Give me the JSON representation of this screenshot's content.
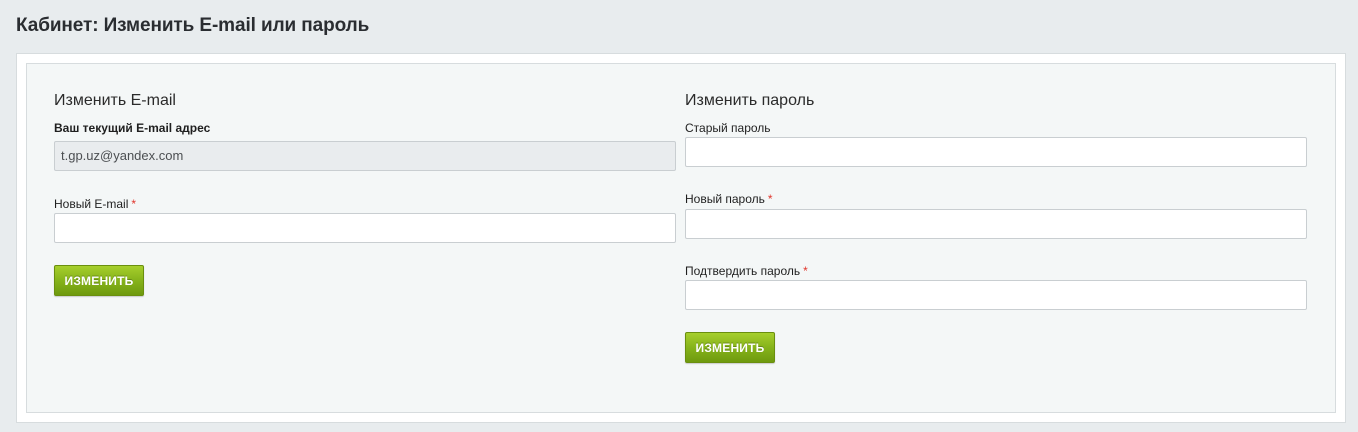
{
  "page": {
    "title": "Кабинет: Изменить E-mail или пароль"
  },
  "email_section": {
    "title": "Изменить E-mail",
    "current_label": "Ваш текущий E-mail адрес",
    "current_value": "t.gp.uz@yandex.com",
    "new_label": "Новый E-mail",
    "new_value": "",
    "required_mark": "*",
    "submit_label": "ИЗМЕНИТЬ"
  },
  "password_section": {
    "title": "Изменить пароль",
    "old_label": "Старый пароль",
    "old_value": "",
    "new_label": "Новый пароль",
    "new_value": "",
    "confirm_label": "Подтвердить пароль",
    "confirm_value": "",
    "required_mark": "*",
    "submit_label": "ИЗМЕНИТЬ"
  },
  "colors": {
    "button_green": "#86b31b",
    "required_red": "#e0352b",
    "panel_background": "#f4f7f7"
  }
}
